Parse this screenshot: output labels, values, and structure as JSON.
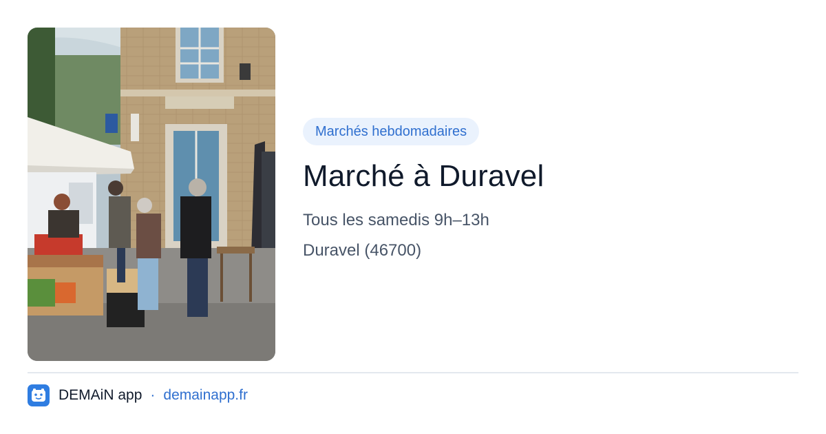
{
  "photo": {
    "subject": "Marché à Duravel"
  },
  "category": "Marchés hebdomadaires",
  "title": "Marché à Duravel",
  "schedule": "Tous les samedis 9h–13h",
  "location": "Duravel (46700)",
  "footer": {
    "app_name": "DEMAiN app",
    "separator": "·",
    "domain": "demainapp.fr"
  },
  "colors": {
    "accent": "#2f6fcf",
    "pill_bg": "#eaf2fd",
    "title": "#101a2b",
    "meta": "#475467",
    "divider": "#e3e8ee",
    "app_icon": "#2f7de1"
  },
  "icons": {
    "app": "demain-app-icon"
  }
}
